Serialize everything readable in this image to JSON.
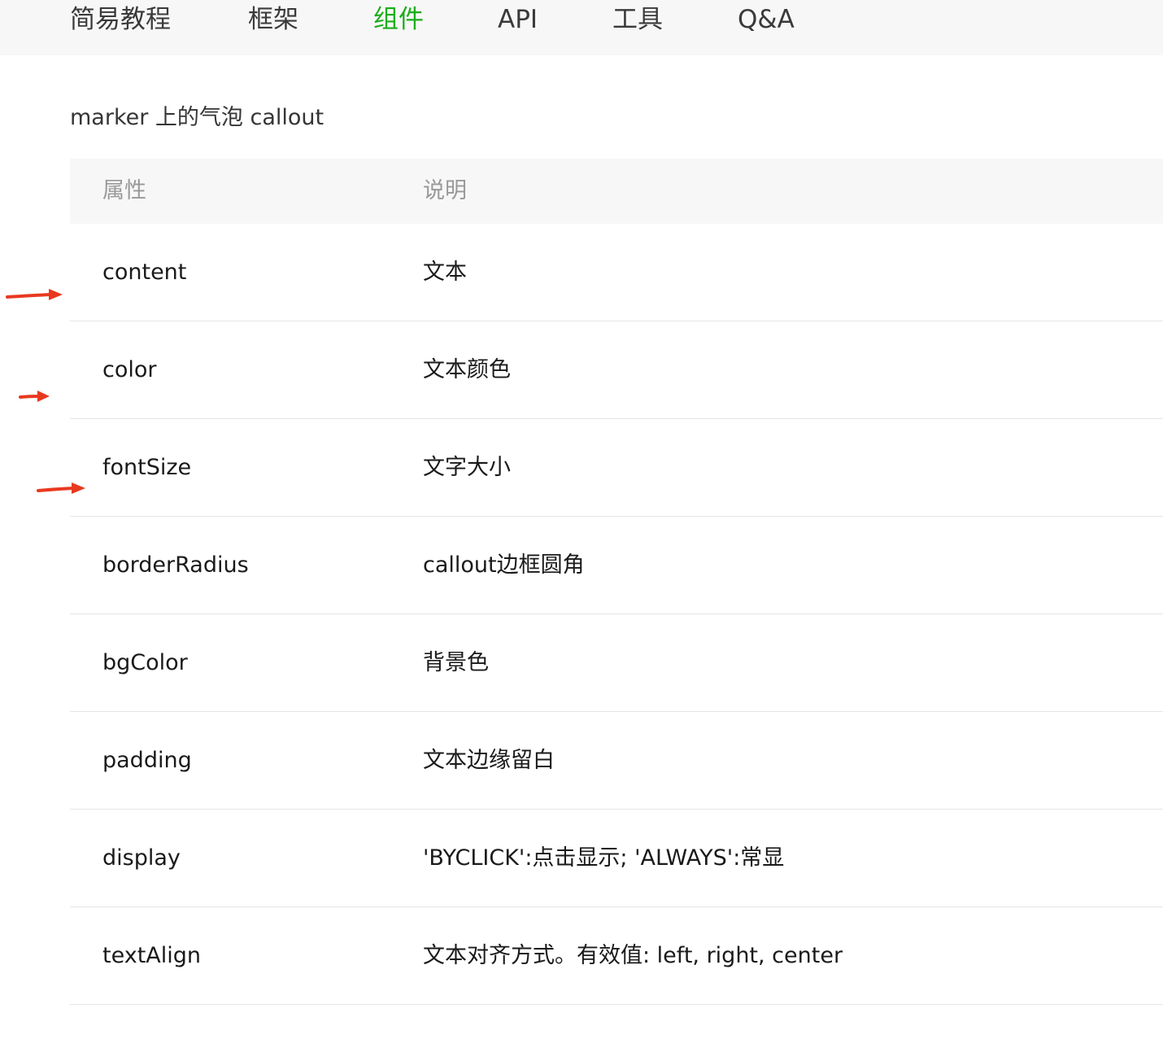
{
  "nav": {
    "items": [
      {
        "label": "简易教程"
      },
      {
        "label": "框架"
      },
      {
        "label": "组件"
      },
      {
        "label": "API"
      },
      {
        "label": "工具"
      },
      {
        "label": "Q&A"
      }
    ],
    "active_index": 2,
    "active_color": "#1aad19"
  },
  "section": {
    "title": "marker 上的气泡 callout"
  },
  "table": {
    "headers": {
      "property": "属性",
      "description": "说明"
    },
    "rows": [
      {
        "property": "content",
        "description": "文本"
      },
      {
        "property": "color",
        "description": "文本颜色"
      },
      {
        "property": "fontSize",
        "description": "文字大小"
      },
      {
        "property": "borderRadius",
        "description": "callout边框圆角"
      },
      {
        "property": "bgColor",
        "description": "背景色"
      },
      {
        "property": "padding",
        "description": "文本边缘留白"
      },
      {
        "property": "display",
        "description": "'BYCLICK':点击显示; 'ALWAYS':常显"
      },
      {
        "property": "textAlign",
        "description": "文本对齐方式。有效值: left, right, center"
      }
    ]
  },
  "annotations": {
    "arrow_color": "#e8391f"
  }
}
